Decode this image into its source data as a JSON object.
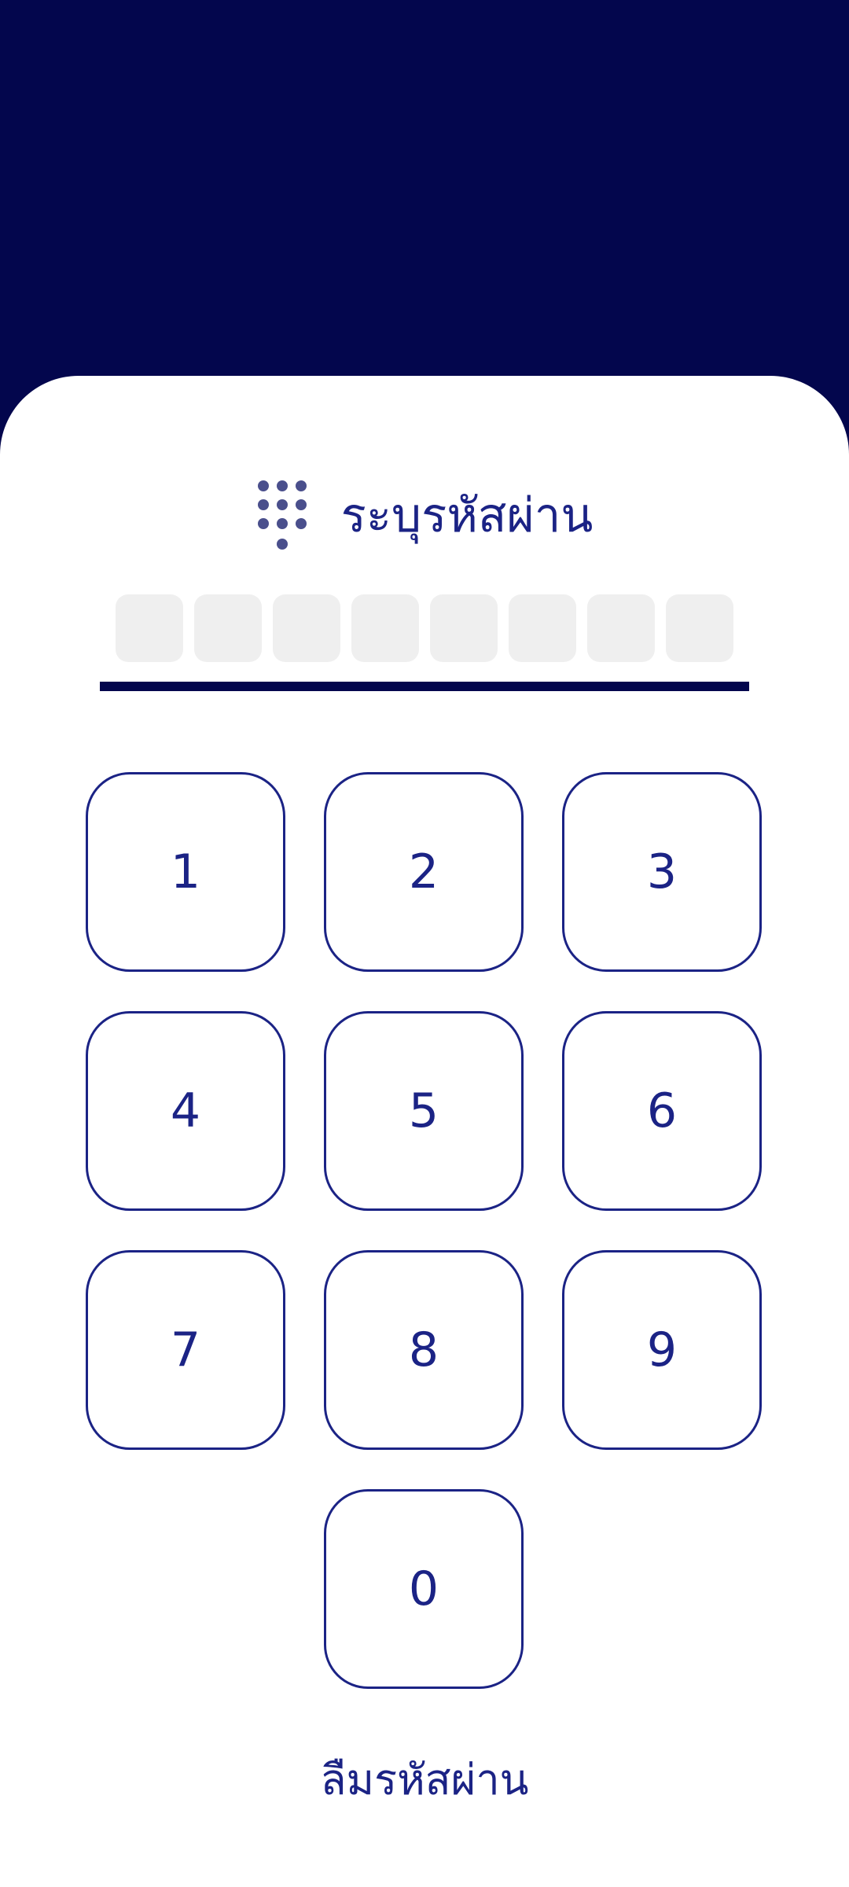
{
  "header": {
    "title": "ระบุรหัสผ่าน",
    "icon": "dialpad-icon"
  },
  "pin": {
    "length": 8,
    "filled": 0
  },
  "keypad": {
    "keys": [
      "1",
      "2",
      "3",
      "4",
      "5",
      "6",
      "7",
      "8",
      "9",
      "0"
    ]
  },
  "footer": {
    "forgot_label": "ลืมรหัสผ่าน"
  },
  "colors": {
    "background": "#03064D",
    "accent": "#1B2385",
    "pin_cell": "#EFEFEF",
    "icon": "#4A4F8C"
  }
}
